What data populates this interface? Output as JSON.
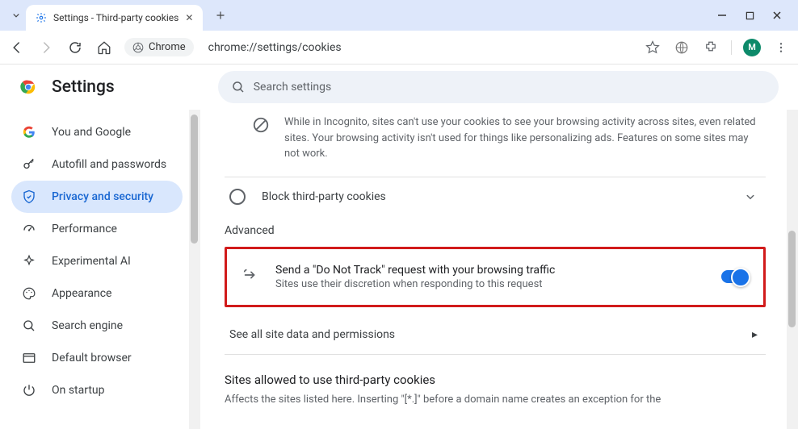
{
  "window": {
    "tab_title": "Settings - Third-party cookies",
    "omnibox_label": "Chrome",
    "url": "chrome://settings/cookies",
    "avatar_initial": "M"
  },
  "header": {
    "title": "Settings",
    "search_placeholder": "Search settings"
  },
  "sidebar": {
    "items": [
      {
        "label": "You and Google",
        "icon": "google"
      },
      {
        "label": "Autofill and passwords",
        "icon": "key"
      },
      {
        "label": "Privacy and security",
        "icon": "shield"
      },
      {
        "label": "Performance",
        "icon": "speed"
      },
      {
        "label": "Experimental AI",
        "icon": "sparkle"
      },
      {
        "label": "Appearance",
        "icon": "palette"
      },
      {
        "label": "Search engine",
        "icon": "search"
      },
      {
        "label": "Default browser",
        "icon": "window"
      },
      {
        "label": "On startup",
        "icon": "power"
      }
    ],
    "active_index": 2
  },
  "content": {
    "incognito_note": "While in Incognito, sites can't use your cookies to see your browsing activity across sites, even related sites. Your browsing activity isn't used for things like personalizing ads. Features on some sites may not work.",
    "block_option": "Block third-party cookies",
    "advanced_label": "Advanced",
    "dnt_title": "Send a \"Do Not Track\" request with your browsing traffic",
    "dnt_sub": "Sites use their discretion when responding to this request",
    "see_all": "See all site data and permissions",
    "allowed_head": "Sites allowed to use third-party cookies",
    "allowed_desc": "Affects the sites listed here. Inserting \"[*.]\" before a domain name creates an exception for the"
  }
}
